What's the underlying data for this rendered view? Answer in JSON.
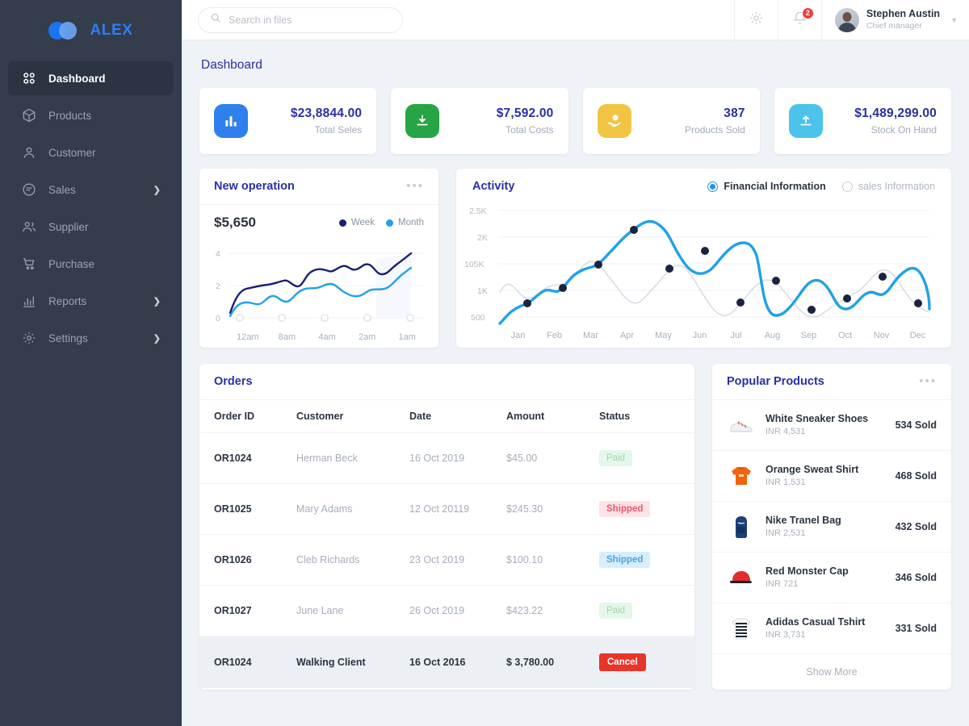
{
  "brand": {
    "name": "ALEX",
    "logo_icon": "two-circles-logo"
  },
  "sidebar": {
    "items": [
      {
        "label": "Dashboard",
        "icon": "grid-icon",
        "active": true,
        "caret": false
      },
      {
        "label": "Products",
        "icon": "box-icon",
        "active": false,
        "caret": false
      },
      {
        "label": "Customer",
        "icon": "user-icon",
        "active": false,
        "caret": false
      },
      {
        "label": "Sales",
        "icon": "receipt-icon",
        "active": false,
        "caret": true
      },
      {
        "label": "Supplier",
        "icon": "users-icon",
        "active": false,
        "caret": false
      },
      {
        "label": "Purchase",
        "icon": "cart-icon",
        "active": false,
        "caret": false
      },
      {
        "label": "Reports",
        "icon": "bar-chart-icon",
        "active": false,
        "caret": true
      },
      {
        "label": "Settings",
        "icon": "gear-icon",
        "active": false,
        "caret": true
      }
    ]
  },
  "topbar": {
    "search": {
      "placeholder": "Search in files",
      "value": "",
      "icon": "search-icon"
    },
    "settings_icon": "gear-icon",
    "notifications": {
      "icon": "bell-icon",
      "count": "2",
      "badge_color": "#f03e3e"
    },
    "user": {
      "name": "Stephen Austin",
      "role": "Chief manager",
      "avatar": "avatar",
      "caret": "chevron-down-icon"
    }
  },
  "page": {
    "title": "Dashboard"
  },
  "stats": [
    {
      "value": "$23,8844.00",
      "label": "Total Seles",
      "icon": "bar-chart-icon",
      "color": "#2f80ed"
    },
    {
      "value": "$7,592.00",
      "label": "Total Costs",
      "icon": "download-icon",
      "color": "#27a544"
    },
    {
      "value": "387",
      "label": "Products Sold",
      "icon": "hand-coin-icon",
      "color": "#f2c444"
    },
    {
      "value": "$1,489,299.00",
      "label": "Stock On Hand",
      "icon": "upload-icon",
      "color": "#4cc3ea"
    }
  ],
  "new_operation": {
    "title": "New operation",
    "menu_icon": "ellipsis-icon",
    "amount": "$5,650",
    "legend": [
      {
        "label": "Week",
        "color": "#1a1f71"
      },
      {
        "label": "Month",
        "color": "#21a1e7"
      }
    ]
  },
  "activity": {
    "title": "Activity",
    "options": [
      {
        "label": "Financial Information",
        "selected": true
      },
      {
        "label": "sales Information",
        "selected": false
      }
    ]
  },
  "orders": {
    "title": "Orders",
    "columns": [
      "Order ID",
      "Customer",
      "Date",
      "Amount",
      "Status"
    ],
    "rows": [
      {
        "id": "OR1024",
        "customer": "Herman Beck",
        "date": "16 Oct 2019",
        "amount": "$45.00",
        "status": "Paid",
        "status_style": "paid",
        "highlight": false
      },
      {
        "id": "OR1025",
        "customer": "Mary Adams",
        "date": "12 Oct 20119",
        "amount": "$245.30",
        "status": "Shipped",
        "status_style": "shipped-pink",
        "highlight": false
      },
      {
        "id": "OR1026",
        "customer": "Cleb Richards",
        "date": "23 Oct 2019",
        "amount": "$100.10",
        "status": "Shipped",
        "status_style": "shipped-blue",
        "highlight": false
      },
      {
        "id": "OR1027",
        "customer": "June Lane",
        "date": "26 Oct 2019",
        "amount": "$423.22",
        "status": "Paid",
        "status_style": "paid",
        "highlight": false
      },
      {
        "id": "OR1024",
        "customer": "Walking Client",
        "date": "16 Oct 2016",
        "amount": "$ 3,780.00",
        "status": "Cancel",
        "status_style": "cancel",
        "highlight": true
      }
    ]
  },
  "popular_products": {
    "title": "Popular Products",
    "menu_icon": "ellipsis-icon",
    "items": [
      {
        "name": "White Sneaker Shoes",
        "price": "INR 4,531",
        "sold": "534 Sold",
        "thumb": "sneaker-thumb"
      },
      {
        "name": "Orange Sweat Shirt",
        "price": "INR 1,531",
        "sold": "468 Sold",
        "thumb": "hoodie-thumb"
      },
      {
        "name": "Nike Tranel Bag",
        "price": "INR 2,531",
        "sold": "432 Sold",
        "thumb": "backpack-thumb"
      },
      {
        "name": "Red Monster Cap",
        "price": "INR 721",
        "sold": "346 Sold",
        "thumb": "cap-thumb"
      },
      {
        "name": "Adidas Casual Tshirt",
        "price": "INR 3,731",
        "sold": "331 Sold",
        "thumb": "tshirt-thumb"
      }
    ],
    "show_more": "Show More"
  },
  "chart_data": [
    {
      "id": "new_operation_chart",
      "type": "line",
      "title": "New operation",
      "xlabel": "",
      "ylabel": "",
      "x": [
        "12am",
        "8am",
        "4am",
        "2am",
        "1am"
      ],
      "tick_labels_y": [
        "0",
        "2",
        "4"
      ],
      "ylim": [
        0,
        4.4
      ],
      "grid": true,
      "legend_position": "top-right",
      "series": [
        {
          "name": "Week",
          "color": "#1a1f71",
          "values": [
            0.85,
            2.1,
            2.3,
            2.35,
            2.6,
            2.2,
            2.25,
            3.0,
            3.25,
            3.1,
            3.4,
            3.3,
            3.65,
            3.3,
            3.15,
            3.3,
            4.0
          ]
        },
        {
          "name": "Month",
          "color": "#21a1e7",
          "values": [
            0.45,
            1.0,
            1.1,
            1.05,
            1.35,
            1.15,
            1.1,
            1.6,
            1.95,
            1.9,
            2.15,
            2.2,
            1.95,
            1.65,
            1.5,
            1.75,
            1.9,
            2.75
          ]
        }
      ]
    },
    {
      "id": "activity_chart",
      "type": "line",
      "title": "Activity",
      "xlabel": "",
      "ylabel": "",
      "categories": [
        "Jan",
        "Feb",
        "Mar",
        "Apr",
        "May",
        "Jun",
        "Jul",
        "Aug",
        "Sep",
        "Oct",
        "Nov",
        "Dec"
      ],
      "tick_labels_y": [
        "500",
        "1K",
        "105K",
        "2K",
        "2.5K"
      ],
      "ylim": [
        400,
        2600
      ],
      "grid": true,
      "legend_position": "none",
      "series": [
        {
          "name": "Financial Information",
          "color": "#21a1e7",
          "marker_color": "#1b2340",
          "values": [
            760,
            1320,
            1900,
            2330,
            1650,
            1880,
            880,
            1330,
            800,
            1010,
            1380,
            880
          ]
        },
        {
          "name": "secondary",
          "color": "#d9dde4",
          "markers": false,
          "values": [
            1010,
            800,
            1120,
            1520,
            1010,
            1310,
            540,
            1120,
            470,
            900,
            1240,
            600
          ]
        }
      ]
    }
  ]
}
